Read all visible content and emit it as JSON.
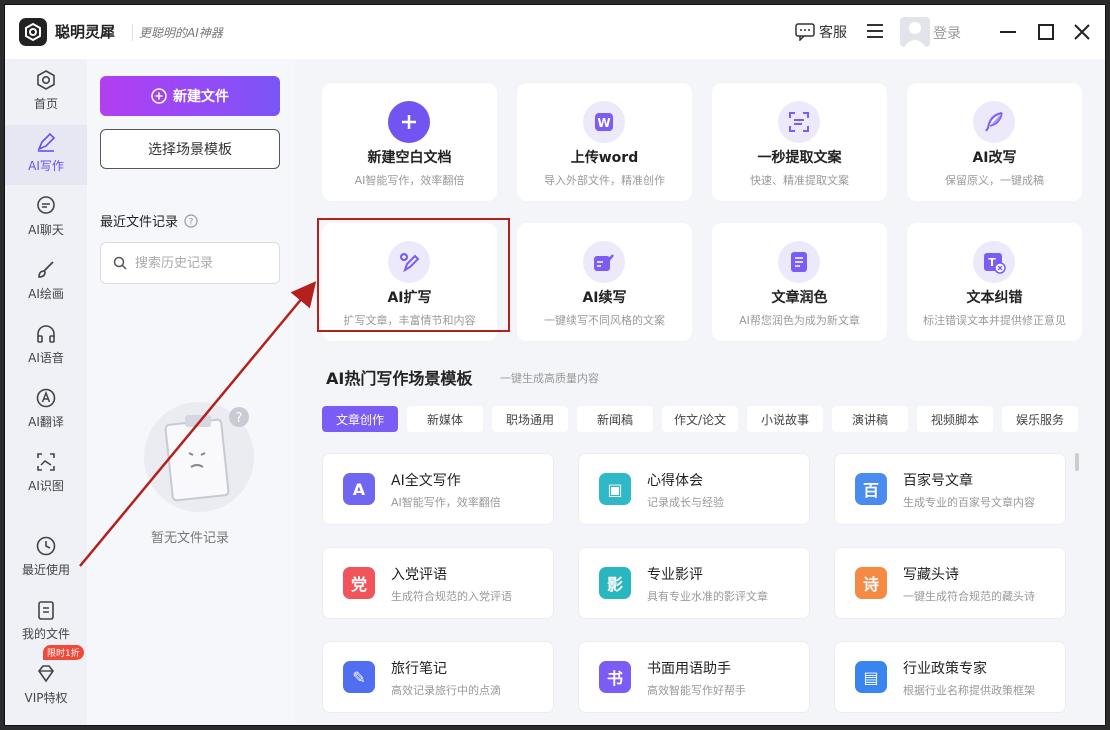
{
  "titlebar": {
    "app_name": "聪明灵犀",
    "slogan": "更聪明的AI神器",
    "service_label": "客服",
    "login_label": "登录"
  },
  "nav": {
    "items": [
      {
        "label": "首页",
        "icon": "home-icon"
      },
      {
        "label": "AI写作",
        "icon": "pen-icon"
      },
      {
        "label": "AI聊天",
        "icon": "chat-icon"
      },
      {
        "label": "AI绘画",
        "icon": "brush-icon"
      },
      {
        "label": "AI语音",
        "icon": "headphone-icon"
      },
      {
        "label": "AI翻译",
        "icon": "translate-icon"
      },
      {
        "label": "AI识图",
        "icon": "image-recognition-icon"
      },
      {
        "label": "最近使用",
        "icon": "clock-icon"
      },
      {
        "label": "我的文件",
        "icon": "file-icon"
      },
      {
        "label": "VIP特权",
        "icon": "diamond-icon",
        "badge": "限时1折"
      }
    ],
    "active_index": 1
  },
  "sidebar": {
    "new_file_label": "新建文件",
    "template_label": "选择场景模板",
    "recent_title": "最近文件记录",
    "search_placeholder": "搜索历史记录",
    "empty_text": "暂无文件记录"
  },
  "feature_cards": [
    {
      "title": "新建空白文档",
      "desc": "AI智能写作，效率翻倍",
      "icon": "plus-icon"
    },
    {
      "title": "上传word",
      "desc": "导入外部文件，精准创作",
      "icon": "word-icon"
    },
    {
      "title": "一秒提取文案",
      "desc": "快速、精准提取文案",
      "icon": "extract-icon"
    },
    {
      "title": "AI改写",
      "desc": "保留原义，一键成稿",
      "icon": "feather-icon"
    },
    {
      "title": "AI扩写",
      "desc": "扩写文章，丰富情节和内容",
      "icon": "expand-pen-icon"
    },
    {
      "title": "AI续写",
      "desc": "一键续写不同风格的文案",
      "icon": "continue-icon"
    },
    {
      "title": "文章润色",
      "desc": "AI帮您润色为成为新文章",
      "icon": "polish-icon"
    },
    {
      "title": "文本纠错",
      "desc": "标注错误文本并提供修正意见",
      "icon": "correct-icon"
    }
  ],
  "section": {
    "title": "AI热门写作场景模板",
    "subtitle": "一键生成高质量内容",
    "categories": [
      "文章创作",
      "新媒体",
      "职场通用",
      "新闻稿",
      "作文/论文",
      "小说故事",
      "演讲稿",
      "视频脚本",
      "娱乐服务"
    ],
    "active_category": 0
  },
  "templates": [
    {
      "title": "AI全文写作",
      "desc": "AI智能写作，效率翻倍",
      "icon_text": "A",
      "color": "#6f66f2"
    },
    {
      "title": "心得体会",
      "desc": "记录成长与经验",
      "icon_text": "▣",
      "color": "#2fb8c8"
    },
    {
      "title": "百家号文章",
      "desc": "生成专业的百家号文章内容",
      "icon_text": "百",
      "color": "#4a8bf0"
    },
    {
      "title": "入党评语",
      "desc": "生成符合规范的入党评语",
      "icon_text": "党",
      "color": "#f2545b"
    },
    {
      "title": "专业影评",
      "desc": "具有专业水准的影评文章",
      "icon_text": "影",
      "color": "#2ab6c0"
    },
    {
      "title": "写藏头诗",
      "desc": "一键生成符合规范的藏头诗",
      "icon_text": "诗",
      "color": "#f58a45"
    },
    {
      "title": "旅行笔记",
      "desc": "高效记录旅行中的点滴",
      "icon_text": "✎",
      "color": "#4f6ff0"
    },
    {
      "title": "书面用语助手",
      "desc": "高效智能写作好帮手",
      "icon_text": "书",
      "color": "#7b5cf5"
    },
    {
      "title": "行业政策专家",
      "desc": "根据行业名称提供政策框架",
      "icon_text": "▤",
      "color": "#3a84f0"
    }
  ]
}
